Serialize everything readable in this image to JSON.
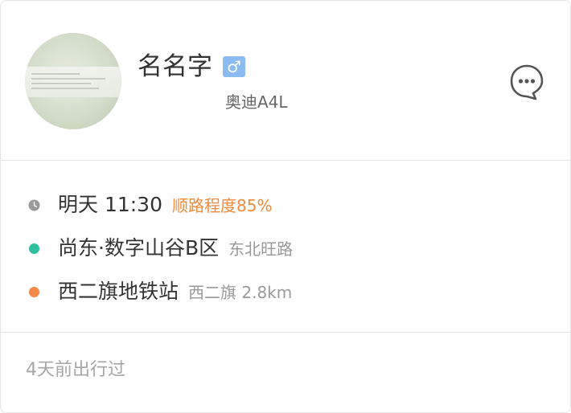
{
  "driver": {
    "name": "名名字",
    "gender_symbol": "♂",
    "car_model": "奥迪A4L"
  },
  "trip": {
    "time": "明天 11:30",
    "match_text": "顺路程度85%",
    "origin_name": "尚东·数字山谷B区",
    "origin_detail": "东北旺路",
    "destination_name": "西二旗地铁站",
    "destination_detail": "西二旗 2.8km"
  },
  "footer": {
    "last_trip": "4天前出行过"
  },
  "colors": {
    "accent_orange": "#f08a3c",
    "origin_dot": "#2dbfa0",
    "destination_dot": "#f5894a",
    "gender_badge": "#8bbcf1",
    "clock_icon": "#9a9a9a"
  },
  "icons": {
    "chat": "chat-bubble-icon",
    "clock": "clock-icon"
  }
}
